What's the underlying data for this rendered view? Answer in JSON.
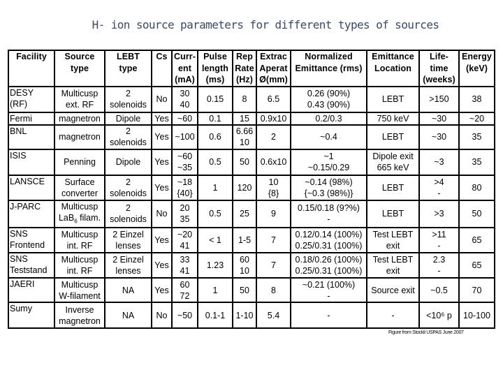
{
  "title": "H- ion source parameters for different types of sources",
  "table": {
    "headers": [
      [
        "Facility"
      ],
      [
        "Source",
        "type"
      ],
      [
        "LEBT",
        "type"
      ],
      [
        "Cs"
      ],
      [
        "Curr-",
        "ent",
        "(mA)"
      ],
      [
        "Pulse",
        "length",
        "(ms)"
      ],
      [
        "Rep",
        "Rate",
        "(Hz)"
      ],
      [
        "Extrac",
        "Aperat",
        "Ø(mm)"
      ],
      [
        "Normalized",
        "Emittance (rms)"
      ],
      [
        "Emittance",
        "Location"
      ],
      [
        "Life-",
        "time",
        "(weeks)"
      ],
      [
        "Energy",
        "(keV)"
      ]
    ],
    "rows": [
      {
        "facility": [
          "DESY",
          "(RF)"
        ],
        "source_type": [
          "Multicusp",
          "ext. RF"
        ],
        "lebt_type": [
          "2",
          "solenoids"
        ],
        "cs": [
          "No"
        ],
        "current": [
          "30",
          "40"
        ],
        "pulse_length": [
          "0.15"
        ],
        "rep_rate": [
          "8"
        ],
        "aperture": [
          "6.5"
        ],
        "emittance": [
          "0.26  (90%)",
          "0.43  (90%)"
        ],
        "location": [
          "LEBT"
        ],
        "lifetime": [
          ">150"
        ],
        "energy": [
          "38"
        ]
      },
      {
        "facility": [
          "Fermi"
        ],
        "source_type": [
          "magnetron"
        ],
        "lebt_type": [
          "Dipole"
        ],
        "cs": [
          "Yes"
        ],
        "current": [
          "~60"
        ],
        "pulse_length": [
          "0.1"
        ],
        "rep_rate": [
          "15"
        ],
        "aperture": [
          "0.9x10"
        ],
        "emittance": [
          "0.2/0.3"
        ],
        "location": [
          "750 keV"
        ],
        "lifetime": [
          "~30"
        ],
        "energy": [
          "~20"
        ]
      },
      {
        "facility": [
          "BNL"
        ],
        "source_type": [
          "magnetron"
        ],
        "lebt_type": [
          "2",
          "solenoids"
        ],
        "cs": [
          "Yes"
        ],
        "current": [
          "~100"
        ],
        "pulse_length": [
          "0.6"
        ],
        "rep_rate": [
          "6.66",
          "10"
        ],
        "aperture": [
          "2"
        ],
        "emittance": [
          "~0.4"
        ],
        "location": [
          "LEBT"
        ],
        "lifetime": [
          "~30"
        ],
        "energy": [
          "35"
        ]
      },
      {
        "facility": [
          "ISIS"
        ],
        "source_type": [
          "Penning"
        ],
        "lebt_type": [
          "Dipole"
        ],
        "cs": [
          "Yes"
        ],
        "current": [
          "~60",
          "~35"
        ],
        "pulse_length": [
          "0.5"
        ],
        "rep_rate": [
          "50"
        ],
        "aperture": [
          "0.6x10"
        ],
        "emittance": [
          "~1",
          "~0.15/0.29"
        ],
        "location": [
          "Dipole exit",
          "665 keV"
        ],
        "lifetime": [
          "~3"
        ],
        "energy": [
          "35"
        ]
      },
      {
        "facility": [
          "LANSCE"
        ],
        "source_type": [
          "Surface",
          "converter"
        ],
        "lebt_type": [
          "2",
          "solenoids"
        ],
        "cs": [
          "Yes"
        ],
        "current": [
          "~18",
          "{40}"
        ],
        "pulse_length": [
          "1"
        ],
        "rep_rate": [
          "120"
        ],
        "aperture": [
          "10",
          "{8}"
        ],
        "emittance": [
          "~0.14  (98%)",
          "{~0.3  (98%)}"
        ],
        "location": [
          "LEBT"
        ],
        "lifetime": [
          ">4",
          "-"
        ],
        "energy": [
          "80"
        ]
      },
      {
        "facility": [
          "J-PARC"
        ],
        "source_type": [
          "Multicusp",
          "LaB6 filam."
        ],
        "lebt_type": [
          "2",
          "solenoids"
        ],
        "cs": [
          "No"
        ],
        "current": [
          "20",
          "35"
        ],
        "pulse_length": [
          "0.5"
        ],
        "rep_rate": [
          "25"
        ],
        "aperture": [
          "9"
        ],
        "emittance": [
          "0.15/0.18 (9?%)",
          "-"
        ],
        "location": [
          "LEBT"
        ],
        "lifetime": [
          ">3"
        ],
        "energy": [
          "50"
        ]
      },
      {
        "facility": [
          "SNS",
          "Frontend"
        ],
        "source_type": [
          "Multicusp",
          "int. RF"
        ],
        "lebt_type": [
          "2 Einzel",
          "lenses"
        ],
        "cs": [
          "Yes"
        ],
        "current": [
          "~20",
          "41"
        ],
        "pulse_length": [
          "< 1"
        ],
        "rep_rate": [
          "1-5"
        ],
        "aperture": [
          "7"
        ],
        "emittance": [
          "0.12/0.14 (100%)",
          "0.25/0.31 (100%)"
        ],
        "location": [
          "Test LEBT",
          "exit"
        ],
        "lifetime": [
          ">11",
          "-"
        ],
        "energy": [
          "65"
        ]
      },
      {
        "facility": [
          "SNS",
          "Teststand"
        ],
        "source_type": [
          "Multicusp",
          "int. RF"
        ],
        "lebt_type": [
          "2 Einzel",
          "lenses"
        ],
        "cs": [
          "Yes"
        ],
        "current": [
          "33",
          "41"
        ],
        "pulse_length": [
          "1.23"
        ],
        "rep_rate": [
          "60",
          "10"
        ],
        "aperture": [
          "7"
        ],
        "emittance": [
          "0.18/0.26 (100%)",
          "0.25/0.31 (100%)"
        ],
        "location": [
          "Test LEBT",
          "exit"
        ],
        "lifetime": [
          "2.3",
          "-"
        ],
        "energy": [
          "65"
        ]
      },
      {
        "facility": [
          "JAERI"
        ],
        "source_type": [
          "Multicusp",
          "W-filament"
        ],
        "lebt_type": [
          "NA"
        ],
        "cs": [
          "Yes"
        ],
        "current": [
          "60",
          "72"
        ],
        "pulse_length": [
          "1"
        ],
        "rep_rate": [
          "50"
        ],
        "aperture": [
          "8"
        ],
        "emittance": [
          "~0.21 (100%)",
          "-"
        ],
        "location": [
          "Source exit"
        ],
        "lifetime": [
          "~0.5"
        ],
        "energy": [
          "70"
        ]
      },
      {
        "facility": [
          "Sumy"
        ],
        "source_type": [
          "Inverse",
          "magnetron"
        ],
        "lebt_type": [
          "NA"
        ],
        "cs": [
          "No"
        ],
        "current": [
          "~50"
        ],
        "pulse_length": [
          "0.1-1"
        ],
        "rep_rate": [
          "1-10"
        ],
        "aperture": [
          "5.4"
        ],
        "emittance": [
          "-"
        ],
        "location": [
          "-"
        ],
        "lifetime": [
          "<10⁶ p"
        ],
        "energy": [
          "10-100"
        ]
      }
    ]
  },
  "footnote": "Figure from Stockli USPAS June 2007"
}
